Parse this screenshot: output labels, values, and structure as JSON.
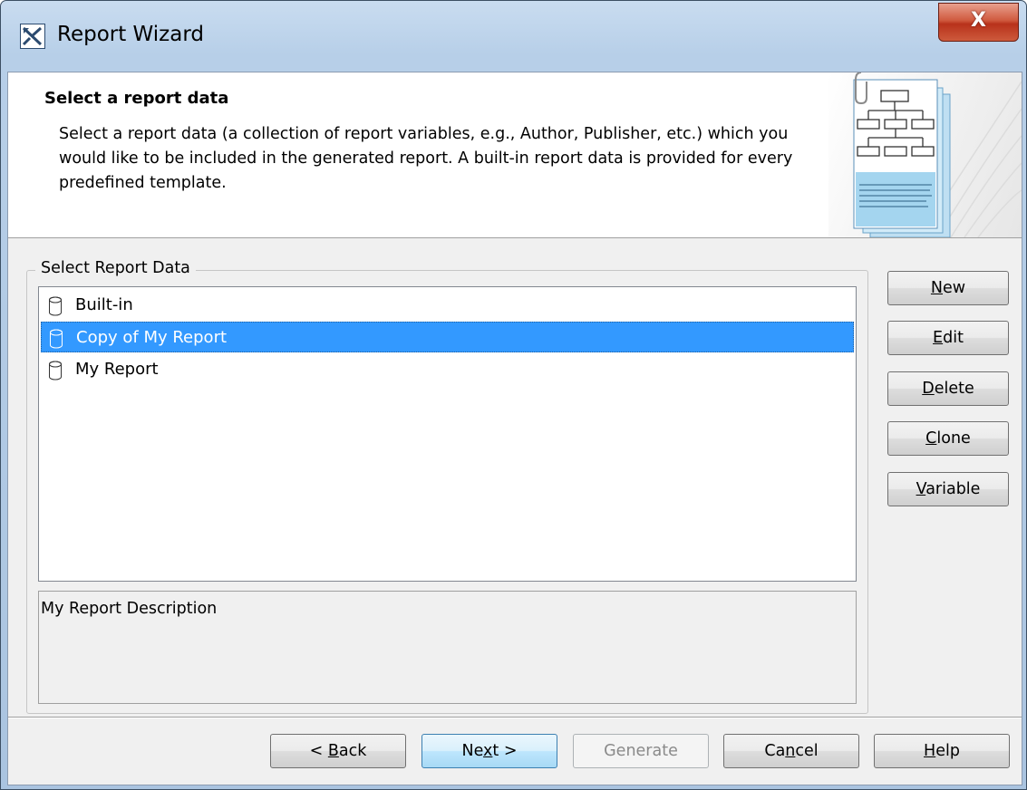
{
  "window": {
    "title": "Report Wizard",
    "close_label": "X"
  },
  "header": {
    "title": "Select a report data",
    "description": "Select a report data (a collection of report variables, e.g., Author, Publisher, etc.) which you would like to be included in the generated report. A built-in report data is provided for every predefined template."
  },
  "report_data": {
    "group_label": "Select Report Data",
    "items": [
      {
        "label": "Built-in",
        "icon": "database-icon",
        "selected": false
      },
      {
        "label": "Copy of My Report",
        "icon": "database-icon",
        "selected": true
      },
      {
        "label": "My Report",
        "icon": "database-icon",
        "selected": false
      }
    ],
    "description": "My Report Description"
  },
  "side_buttons": {
    "new": {
      "mnemonic": "N",
      "rest": "ew"
    },
    "edit": {
      "mnemonic": "E",
      "rest": "dit"
    },
    "delete": {
      "mnemonic": "D",
      "rest": "elete"
    },
    "clone": {
      "mnemonic": "C",
      "rest": "lone"
    },
    "variable": {
      "mnemonic": "V",
      "rest": "ariable"
    }
  },
  "footer": {
    "back": {
      "pre": "< ",
      "mnemonic": "B",
      "post": "ack"
    },
    "next": {
      "pre": "Ne",
      "mnemonic": "x",
      "post": "t >"
    },
    "generate": {
      "label": "Generate",
      "enabled": false
    },
    "cancel": {
      "pre": "Ca",
      "mnemonic": "n",
      "post": "cel"
    },
    "help": {
      "pre": "",
      "mnemonic": "H",
      "post": "elp"
    }
  },
  "colors": {
    "selection": "#3399ff",
    "close_button": "#c7412a",
    "title_bar": "#b9d1ea"
  }
}
